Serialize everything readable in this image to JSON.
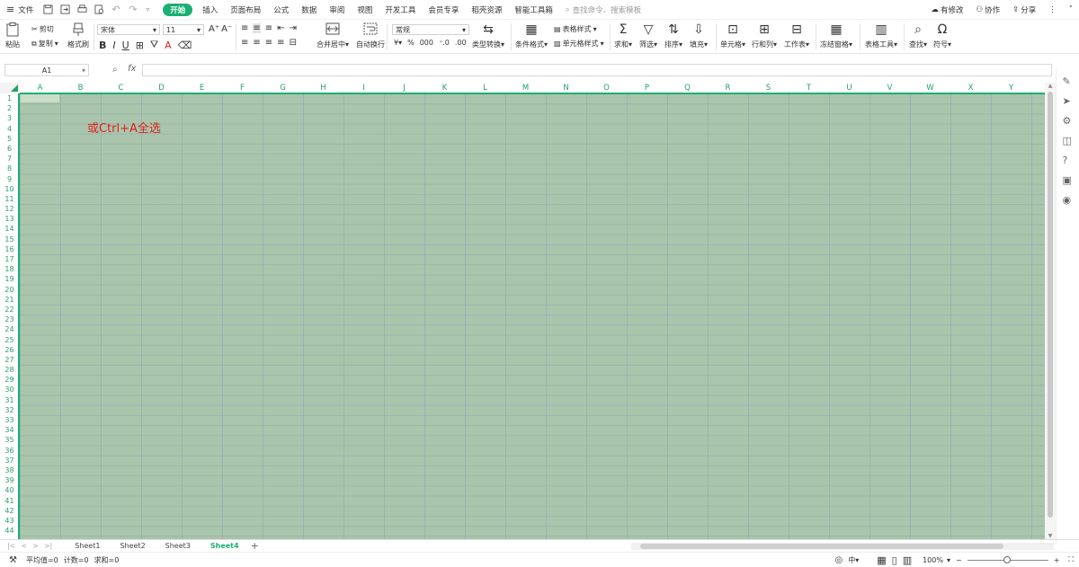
{
  "menu": {
    "file": "文件",
    "tabs": [
      "开始",
      "插入",
      "页面布局",
      "公式",
      "数据",
      "审阅",
      "视图",
      "开发工具",
      "会员专享",
      "稻壳资源",
      "智能工具箱"
    ],
    "search_placeholder": "查找命令、搜索模板",
    "unsaved": "有修改",
    "collab": "协作",
    "share": "分享"
  },
  "toolbar": {
    "paste": "粘贴",
    "cut": "剪切",
    "copy": "复制",
    "format_painter": "格式刷",
    "font_name": "宋体",
    "font_size": "11",
    "merge": "合并居中",
    "wrap": "自动换行",
    "number_format": "常规",
    "type_convert": "类型转换",
    "cond_format": "条件格式",
    "table_style": "表格样式",
    "cell_style": "单元格样式",
    "sum": "求和",
    "filter": "筛选",
    "sort": "排序",
    "fill": "填充",
    "cell": "单元格",
    "rowcol": "行和列",
    "sheet": "工作表",
    "freeze": "冻结窗格",
    "table_tools": "表格工具",
    "find": "查找",
    "symbol": "符号"
  },
  "formula": {
    "namebox": "A1",
    "fx": "fx",
    "value": ""
  },
  "columns": [
    "A",
    "B",
    "C",
    "D",
    "E",
    "F",
    "G",
    "H",
    "I",
    "J",
    "K",
    "L",
    "M",
    "N",
    "O",
    "P",
    "Q",
    "R",
    "S",
    "T",
    "U",
    "V",
    "W",
    "X",
    "Y"
  ],
  "rows": [
    "1",
    "2",
    "3",
    "4",
    "5",
    "6",
    "7",
    "8",
    "9",
    "10",
    "11",
    "12",
    "13",
    "14",
    "15",
    "16",
    "17",
    "18",
    "19",
    "20",
    "21",
    "22",
    "23",
    "24",
    "25",
    "26",
    "27",
    "28",
    "29",
    "30",
    "31",
    "32",
    "33",
    "34",
    "35",
    "36",
    "37",
    "38",
    "39",
    "40",
    "41",
    "42",
    "43",
    "44"
  ],
  "annotation": "或Ctrl+A全选",
  "sheets": [
    "Sheet1",
    "Sheet2",
    "Sheet3",
    "Sheet4"
  ],
  "active_sheet": "Sheet4",
  "status": {
    "avg": "平均值=0",
    "count": "计数=0",
    "sum": "求和=0",
    "zoom": "100%"
  },
  "colors": {
    "accent": "#1aaf74",
    "selection": "#a9c5ab",
    "annotation": "#e02020"
  }
}
